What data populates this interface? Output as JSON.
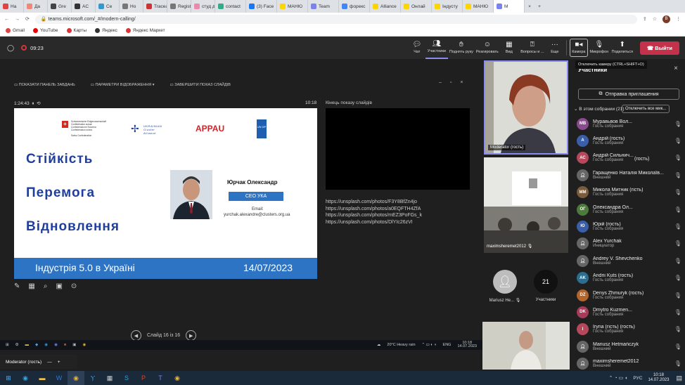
{
  "browser": {
    "tabs": [
      "Ha",
      "Дa",
      "Gre",
      "AC",
      "Се",
      "Но",
      "Traceal",
      "Registr",
      "студ д",
      "contact",
      "(3) Face",
      "МАНЮ",
      "Team",
      "форекс",
      "Alliance",
      "Онлай",
      "Індусту",
      "МАНЮ",
      "М",
      "×",
      "+"
    ],
    "url": "teams.microsoft.com/_#/modern-calling/",
    "bookmarks": [
      "Gmail",
      "YouTube",
      "Карты",
      "Яндекс",
      "Яндекс Маркет"
    ]
  },
  "call": {
    "timer": "09:23"
  },
  "toolbar": {
    "chat": "Чат",
    "participants": "Участники",
    "raise_hand": "Поднять руку",
    "react": "Реагировать",
    "view": "Вид",
    "qna": "Вопросы и ...",
    "more": "Еще",
    "camera": "Камера",
    "mic": "Микрофон",
    "share": "Поделиться",
    "leave": "Выйти",
    "tooltip": "Отключить камеру (CTRL+SHIFT+O)"
  },
  "presenter": {
    "taskbar_btn": "ПОКАЗАТИ ПАНЕЛЬ ЗАВДАНЬ",
    "settings_btn": "ПАРАМЕТРИ ВІДОБРАЖЕННЯ ▾",
    "end_btn": "ЗАВЕРШИТИ ПОКАЗ СЛАЙДІВ",
    "elapsed": "1:24:43",
    "clock": "10:18",
    "end_label": "Кінець показу слайдів",
    "slide_counter": "Слайд 16 із 16",
    "notes_links": [
      "https://unsplash.com/photos/F3Y8BfZn4jo",
      "https://unsplash.com/photos/a0EQFTH4ZfA",
      "https://unsplash.com/photos/mEZ3PoFGs_k",
      "https://unsplash.com/photos/DlYIc26zVI"
    ]
  },
  "slide": {
    "swiss_lines": [
      "Schweizerische Eidgenossenschaft",
      "Confédération suisse",
      "Confederazione Svizzera",
      "Confederaziun svizra",
      "",
      "Swiss Confederation"
    ],
    "uca_line1": "UKRAINIAN",
    "uca_line2": "Cluster",
    "uca_line3": "Alliance",
    "appau": "APPAU",
    "undp": "UN DP",
    "word1": "Стійкість",
    "word2": "Перемога",
    "word3": "Відновлення",
    "person_name": "Юрчак Олександр",
    "person_role": "CEO УКА",
    "email_label": "Email:",
    "email": "yurchak.alexandre@clusters.org.ua",
    "footer_title": "Індустрія 5.0 в Україні",
    "footer_date": "14/07/2023"
  },
  "video": {
    "moderator": "Moderator (гость)",
    "maxim": "maximsheremet2012",
    "mariusz_initials": "Mariusz He...",
    "count": "21",
    "count_label": "Участники"
  },
  "roster": {
    "title": "Участники",
    "invite": "Отправка приглашения",
    "section": "В этом собрании (21)",
    "mute_all": "Отключить все мик...",
    "people": [
      {
        "initials": "МВ",
        "name": "Муравьвов Вол...",
        "role": "Гость собрания",
        "color": "#8a4a8f"
      },
      {
        "initials": "А",
        "name": "Андрій (гость)",
        "role": "Гость собрания",
        "color": "#3a5fa8"
      },
      {
        "initials": "АС",
        "name": "Андрій Сильнич...",
        "role": "Гость собрания",
        "color": "#b5495b"
      },
      {
        "initials": "",
        "name": "Гаращенко Наталія Миколаїв...",
        "role": "Внешний",
        "color": "#555"
      },
      {
        "initials": "ММ",
        "name": "Микола Митник (гість)",
        "role": "Гость собрания",
        "color": "#7b5b3a"
      },
      {
        "initials": "ОГ",
        "name": "Олександра Ол...",
        "role": "Гость собрания",
        "color": "#4d7a3a"
      },
      {
        "initials": "Ю",
        "name": "Юрій (гость)",
        "role": "Гость собрания",
        "color": "#3a5fa8"
      },
      {
        "initials": "",
        "name": "Alex Yurchak",
        "role": "Инициатор",
        "color": "#555"
      },
      {
        "initials": "",
        "name": "Andrey V. Shevchenko",
        "role": "Внешний",
        "color": "#555"
      },
      {
        "initials": "AK",
        "name": "Andrii Kuts (гость)",
        "role": "Гость собрания",
        "color": "#2c6e8f"
      },
      {
        "initials": "DZ",
        "name": "Denys Zhmuryk (гость)",
        "role": "Гость собрания",
        "color": "#b3652e"
      },
      {
        "initials": "DK",
        "name": "Dmytro Kuzmen...",
        "role": "Гость собрания",
        "color": "#a63b5a"
      },
      {
        "initials": "I",
        "name": "Iryna (гість) (гость)",
        "role": "Гость собрания",
        "color": "#b5495b"
      },
      {
        "initials": "",
        "name": "Mariusz Hetmańczyk",
        "role": "Внешний",
        "color": "#555"
      },
      {
        "initials": "",
        "name": "maximsheremet2012",
        "role": "Внешний",
        "color": "#555"
      }
    ],
    "extra_labels": [
      "(гість)",
      "(гость)"
    ]
  },
  "taskbar": {
    "pip_label": "Moderator (гость)",
    "weather": "20°C Heavy rain",
    "lang": "ENG",
    "time": "10:18",
    "date": "14.07.2023",
    "lang2": "РУС"
  }
}
